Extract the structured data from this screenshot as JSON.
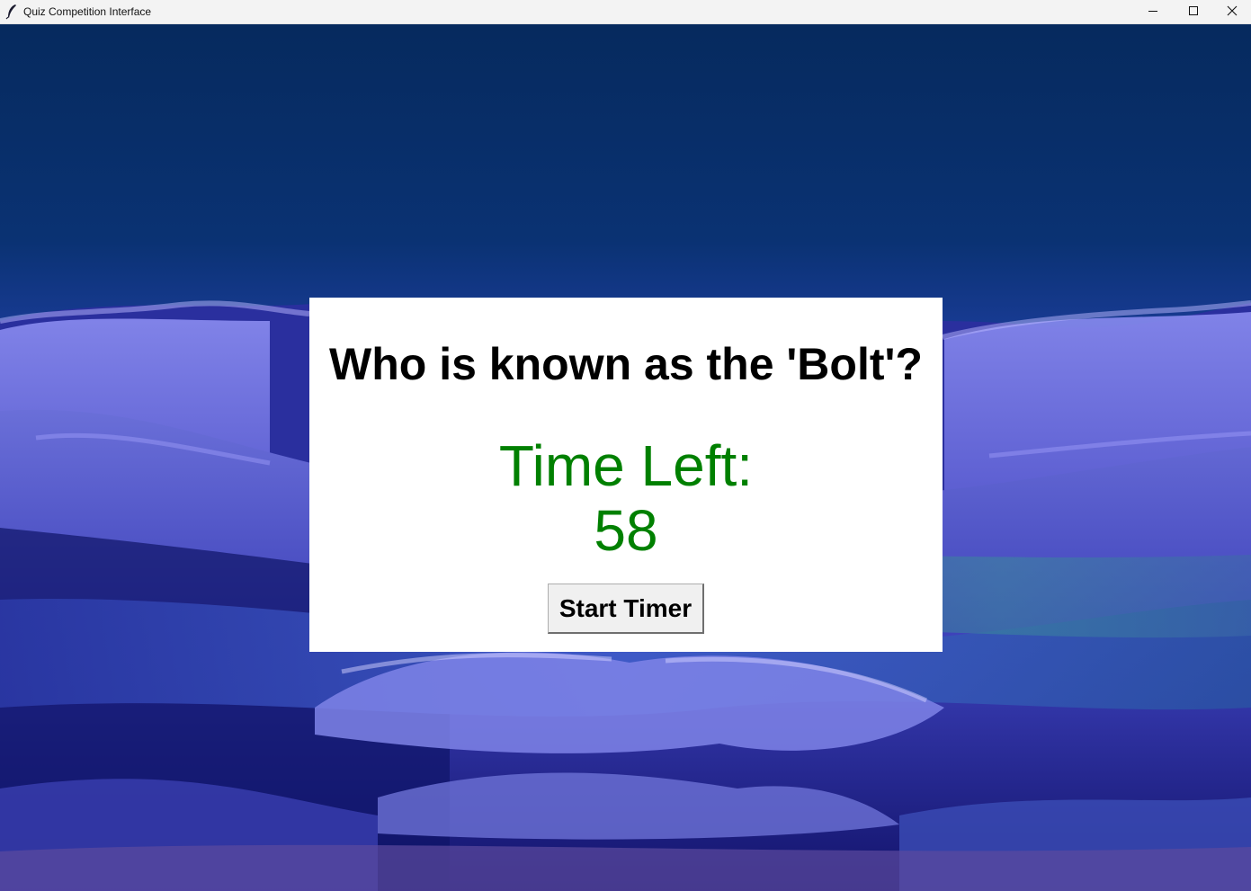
{
  "window": {
    "title": "Quiz Competition Interface",
    "controls": [
      "minimize-icon",
      "maximize-icon",
      "close-icon"
    ]
  },
  "quiz": {
    "question": "Who is known as the 'Bolt'?",
    "timer_label": "Time Left:",
    "timer_value": "58",
    "start_button_label": "Start Timer"
  },
  "colors": {
    "panel_background": "#ffffff",
    "question_text": "#000000",
    "timer_text": "#008000",
    "button_background": "#f0f0f0",
    "sky": "#0a2a6e"
  }
}
